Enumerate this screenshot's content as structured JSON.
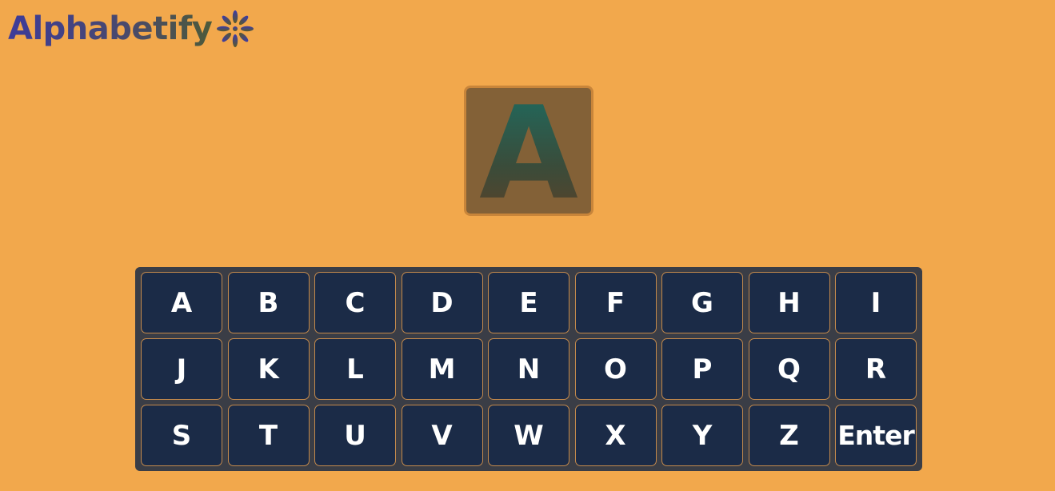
{
  "app": {
    "logo_text": "Alphabetify",
    "logo_icon": "flower-burst-icon"
  },
  "display": {
    "current_letter": "A"
  },
  "keyboard": {
    "keys": [
      "A",
      "B",
      "C",
      "D",
      "E",
      "F",
      "G",
      "H",
      "I",
      "J",
      "K",
      "L",
      "M",
      "N",
      "O",
      "P",
      "Q",
      "R",
      "S",
      "T",
      "U",
      "V",
      "W",
      "X",
      "Y",
      "Z",
      "Enter"
    ]
  },
  "colors": {
    "background": "#f2a84c",
    "tile": "#836137",
    "keyboard_frame": "#3a3d46",
    "key": "#1b2b47",
    "key_border": "#c48a4c",
    "key_text": "#ffffff"
  }
}
